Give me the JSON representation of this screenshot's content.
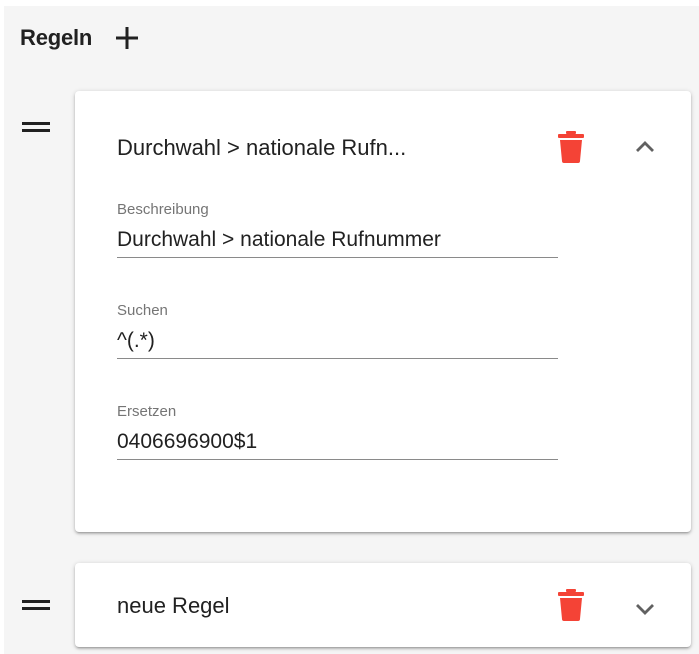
{
  "header": {
    "title": "Regeln",
    "add_icon": "plus-icon"
  },
  "rules": [
    {
      "title": "Durchwahl > nationale Rufn...",
      "expanded": true,
      "icons": {
        "drag": "drag-handle-icon",
        "delete": "trash-icon",
        "toggle": "chevron-up-icon"
      },
      "fields": {
        "description": {
          "label": "Beschreibung",
          "value": "Durchwahl > nationale Rufnummer"
        },
        "search": {
          "label": "Suchen",
          "value": "^(.*)"
        },
        "replace": {
          "label": "Ersetzen",
          "value": "0406696900$1"
        }
      }
    },
    {
      "title": "neue Regel",
      "expanded": false,
      "icons": {
        "drag": "drag-handle-icon",
        "delete": "trash-icon",
        "toggle": "chevron-down-icon"
      }
    }
  ],
  "colors": {
    "delete": "#f44336",
    "panel_bg": "#f5f5f5",
    "text": "#212121",
    "label": "#757575"
  }
}
